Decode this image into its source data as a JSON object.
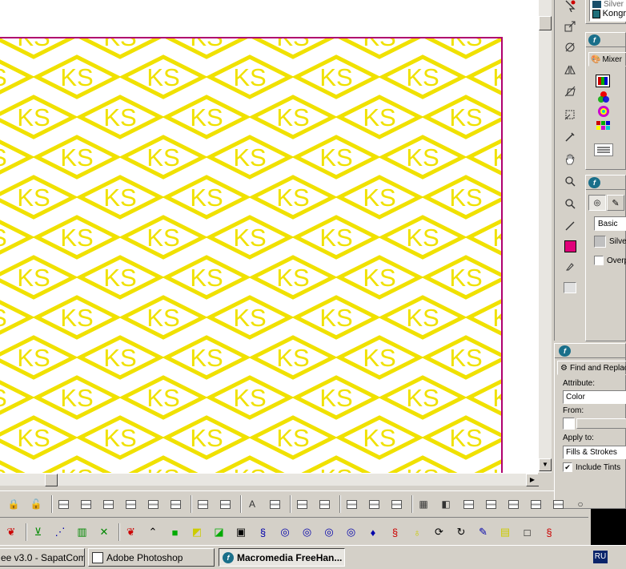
{
  "canvas": {
    "pattern_text": "KS",
    "pattern_color": "#f0e100",
    "page_border_color": "#b0006e"
  },
  "toolbox": {
    "fill_color": "#e0007a",
    "tools": [
      "pointer-icon",
      "scale-icon",
      "rotate-icon",
      "reflect-icon",
      "skew-icon",
      "trace-icon",
      "eyedropper-icon",
      "hand-icon",
      "zoom-icon",
      "zoom-out-icon",
      "line-icon",
      "fill-swatch",
      "knife-icon",
      "stroke-swatch"
    ]
  },
  "swatches_panel": {
    "items": [
      "Silver",
      "Kongr"
    ]
  },
  "mixer_panel": {
    "tab_label": "Mixer"
  },
  "fill_panel": {
    "type_value": "Basic",
    "color_label": "Silve",
    "overprint_label": "Overp"
  },
  "find_replace_panel": {
    "title": "Find and Replace",
    "attribute_label": "Attribute:",
    "attribute_value": "Color",
    "from_label": "From:",
    "apply_to_label": "Apply to:",
    "apply_to_value": "Fills & Strokes",
    "include_tints_label": "Include Tints"
  },
  "taskbar": {
    "tasks": [
      {
        "label": "ee v3.0 - SapatCom"
      },
      {
        "label": "Adobe Photoshop"
      },
      {
        "label": "Macromedia FreeHan..."
      }
    ],
    "language": "RU"
  }
}
